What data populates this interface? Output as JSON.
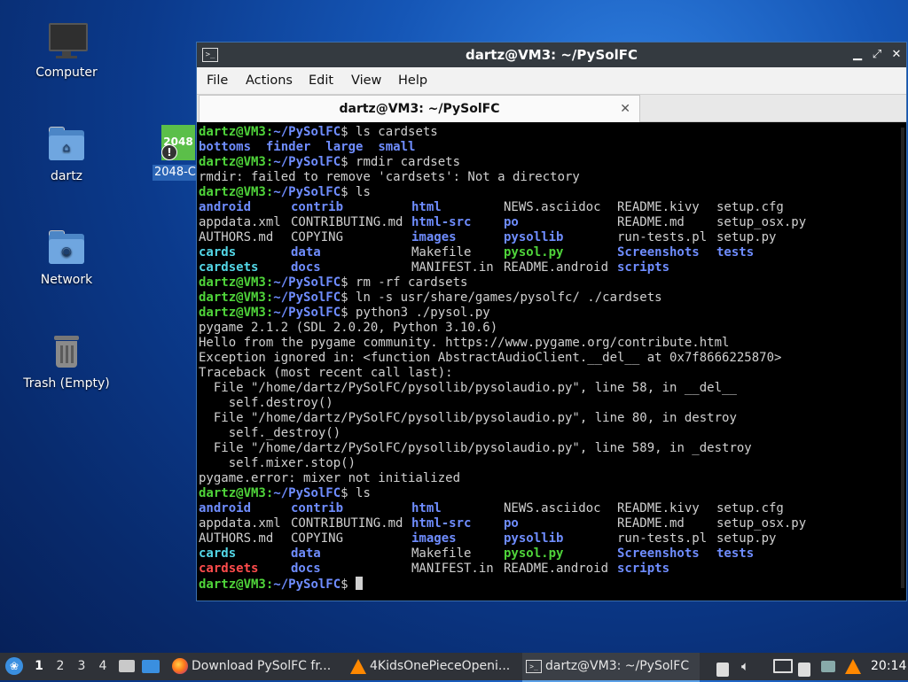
{
  "desktop": {
    "icons": [
      {
        "label": "Computer"
      },
      {
        "label": "dartz"
      },
      {
        "label": "Network"
      },
      {
        "label": "Trash (Empty)"
      }
    ],
    "game_icon": {
      "badge": "2048",
      "label": "2048-C"
    }
  },
  "window": {
    "title": "dartz@VM3: ~/PySolFC",
    "controls": {
      "minimize": "✕",
      "maximize": "⤡",
      "close": "✕"
    },
    "menu": [
      "File",
      "Actions",
      "Edit",
      "View",
      "Help"
    ],
    "tab": {
      "label": "dartz@VM3: ~/PySolFC",
      "close": "✕"
    }
  },
  "terminal": {
    "prompt_user": "dartz@VM3:",
    "prompt_path": "~/PySolFC",
    "lines": [
      {
        "type": "prompt",
        "cmd": "ls cardsets"
      },
      {
        "type": "ls1",
        "items": [
          "bottoms",
          "finder",
          "large",
          "small"
        ]
      },
      {
        "type": "prompt",
        "cmd": "rmdir cardsets"
      },
      {
        "type": "text",
        "text": "rmdir: failed to remove 'cardsets': Not a directory"
      },
      {
        "type": "prompt",
        "cmd": "ls"
      },
      {
        "type": "row",
        "cells": [
          [
            "android",
            "dir"
          ],
          [
            "contrib",
            "dir"
          ],
          [
            "html",
            "dir"
          ],
          [
            "NEWS.asciidoc",
            "plain"
          ],
          [
            "README.kivy",
            "plain"
          ],
          [
            "setup.cfg",
            "plain"
          ]
        ]
      },
      {
        "type": "row",
        "cells": [
          [
            "appdata.xml",
            "plain"
          ],
          [
            "CONTRIBUTING.md",
            "plain"
          ],
          [
            "html-src",
            "dir"
          ],
          [
            "po",
            "dir"
          ],
          [
            "README.md",
            "plain"
          ],
          [
            "setup_osx.py",
            "plain"
          ]
        ]
      },
      {
        "type": "row",
        "cells": [
          [
            "AUTHORS.md",
            "plain"
          ],
          [
            "COPYING",
            "plain"
          ],
          [
            "images",
            "dir"
          ],
          [
            "pysollib",
            "dir"
          ],
          [
            "run-tests.pl",
            "plain"
          ],
          [
            "setup.py",
            "plain"
          ]
        ]
      },
      {
        "type": "row",
        "cells": [
          [
            "cards",
            "lnk"
          ],
          [
            "data",
            "dir"
          ],
          [
            "Makefile",
            "plain"
          ],
          [
            "pysol.py",
            "exec"
          ],
          [
            "Screenshots",
            "dir"
          ],
          [
            "tests",
            "dir"
          ]
        ]
      },
      {
        "type": "row",
        "cells": [
          [
            "cardsets",
            "lnk"
          ],
          [
            "docs",
            "dir"
          ],
          [
            "MANIFEST.in",
            "plain"
          ],
          [
            "README.android",
            "plain"
          ],
          [
            "scripts",
            "dir"
          ],
          [
            "",
            ""
          ]
        ]
      },
      {
        "type": "prompt",
        "cmd": "rm -rf cardsets"
      },
      {
        "type": "prompt",
        "cmd": "ln -s usr/share/games/pysolfc/ ./cardsets"
      },
      {
        "type": "prompt",
        "cmd": "python3 ./pysol.py"
      },
      {
        "type": "text",
        "text": "pygame 2.1.2 (SDL 2.0.20, Python 3.10.6)"
      },
      {
        "type": "text",
        "text": "Hello from the pygame community. https://www.pygame.org/contribute.html"
      },
      {
        "type": "text",
        "text": "Exception ignored in: <function AbstractAudioClient.__del__ at 0x7f8666225870>"
      },
      {
        "type": "text",
        "text": "Traceback (most recent call last):"
      },
      {
        "type": "text",
        "text": "  File \"/home/dartz/PySolFC/pysollib/pysolaudio.py\", line 58, in __del__"
      },
      {
        "type": "text",
        "text": "    self.destroy()"
      },
      {
        "type": "text",
        "text": "  File \"/home/dartz/PySolFC/pysollib/pysolaudio.py\", line 80, in destroy"
      },
      {
        "type": "text",
        "text": "    self._destroy()"
      },
      {
        "type": "text",
        "text": "  File \"/home/dartz/PySolFC/pysollib/pysolaudio.py\", line 589, in _destroy"
      },
      {
        "type": "text",
        "text": "    self.mixer.stop()"
      },
      {
        "type": "text",
        "text": "pygame.error: mixer not initialized"
      },
      {
        "type": "prompt",
        "cmd": "ls"
      },
      {
        "type": "row",
        "cells": [
          [
            "android",
            "dir"
          ],
          [
            "contrib",
            "dir"
          ],
          [
            "html",
            "dir"
          ],
          [
            "NEWS.asciidoc",
            "plain"
          ],
          [
            "README.kivy",
            "plain"
          ],
          [
            "setup.cfg",
            "plain"
          ]
        ]
      },
      {
        "type": "row",
        "cells": [
          [
            "appdata.xml",
            "plain"
          ],
          [
            "CONTRIBUTING.md",
            "plain"
          ],
          [
            "html-src",
            "dir"
          ],
          [
            "po",
            "dir"
          ],
          [
            "README.md",
            "plain"
          ],
          [
            "setup_osx.py",
            "plain"
          ]
        ]
      },
      {
        "type": "row",
        "cells": [
          [
            "AUTHORS.md",
            "plain"
          ],
          [
            "COPYING",
            "plain"
          ],
          [
            "images",
            "dir"
          ],
          [
            "pysollib",
            "dir"
          ],
          [
            "run-tests.pl",
            "plain"
          ],
          [
            "setup.py",
            "plain"
          ]
        ]
      },
      {
        "type": "row",
        "cells": [
          [
            "cards",
            "lnk"
          ],
          [
            "data",
            "dir"
          ],
          [
            "Makefile",
            "plain"
          ],
          [
            "pysol.py",
            "exec"
          ],
          [
            "Screenshots",
            "dir"
          ],
          [
            "tests",
            "dir"
          ]
        ]
      },
      {
        "type": "row",
        "cells": [
          [
            "cardsets",
            "broken"
          ],
          [
            "docs",
            "dir"
          ],
          [
            "MANIFEST.in",
            "plain"
          ],
          [
            "README.android",
            "plain"
          ],
          [
            "scripts",
            "dir"
          ],
          [
            "",
            ""
          ]
        ]
      },
      {
        "type": "prompt_cursor",
        "cmd": ""
      }
    ]
  },
  "taskbar": {
    "workspaces": [
      "1",
      "2",
      "3",
      "4"
    ],
    "active_workspace": "1",
    "tasks": [
      {
        "label": "Download PySolFC fr...",
        "icon": "firefox-icon"
      },
      {
        "label": "4KidsOnePieceOpeni...",
        "icon": "vlc-icon"
      },
      {
        "label": "dartz@VM3: ~/PySolFC",
        "icon": "terminal-icon"
      }
    ],
    "clock": "20:14"
  }
}
